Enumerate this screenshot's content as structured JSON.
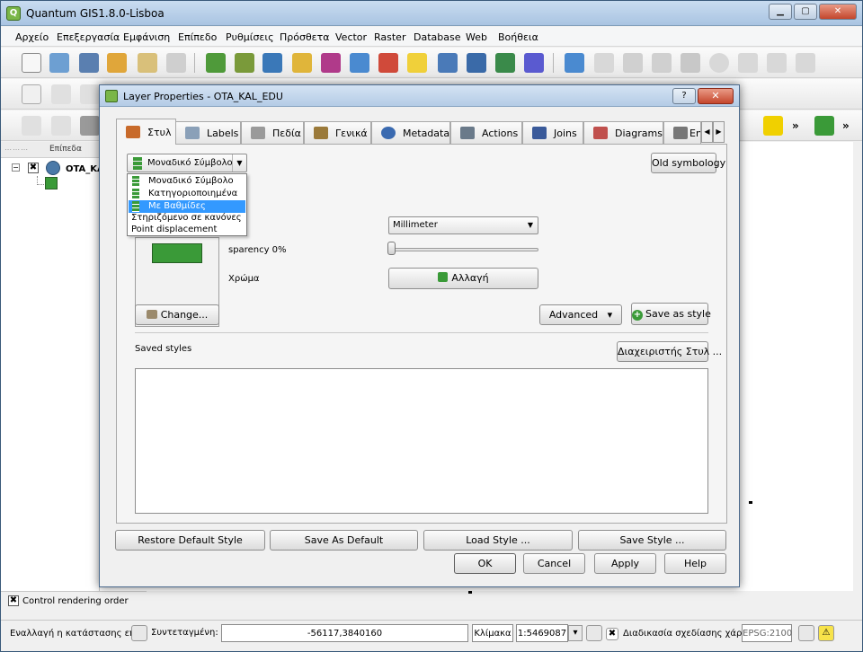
{
  "main_window": {
    "title": "Quantum GIS1.8.0-Lisboa",
    "controls": {
      "minimize": "▁",
      "maximize": "▢",
      "close": "✕"
    }
  },
  "menu": [
    "Αρχείο",
    "Επεξεργασία",
    "Εμφάνιση",
    "Επίπεδο",
    "Ρυθμίσεις",
    "Πρόσθετα",
    "Vector",
    "Raster",
    "Database",
    "Web",
    "Βοήθεια"
  ],
  "toolbar": {
    "more": "»"
  },
  "layers_panel": {
    "header": "Επίπεδα",
    "layer_name": "OTA_KA",
    "expander": "−",
    "check": "✖"
  },
  "control_rendering_order": {
    "label": "Control rendering order",
    "check": "✖"
  },
  "statusbar": {
    "toggle_label": "Εναλλαγή η κατάστασης επεξ",
    "coord_label": "Συντεταγμένη:",
    "coord_value": "-56117,3840160",
    "scale_label": "Κλίμακα",
    "scale_value": "1:5469087",
    "render_label": "Διαδικασία σχεδίασης χάρτη",
    "render_check": "✖",
    "epsg": "EPSG:2100",
    "warn": "⚠"
  },
  "dialog": {
    "title": "Layer Properties - OTA_KAL_EDU",
    "help": "?",
    "close": "✕",
    "tabs": [
      {
        "label": "Στυλ",
        "color": "#c86a2a"
      },
      {
        "label": "Labels",
        "color": "#8aa0b8"
      },
      {
        "label": "Πεδία",
        "color": "#9a9a9a"
      },
      {
        "label": "Γενικά",
        "color": "#9b7a3a"
      },
      {
        "label": "Metadata",
        "color": "#3a6ab0"
      },
      {
        "label": "Actions",
        "color": "#6a7a8a"
      },
      {
        "label": "Joins",
        "color": "#3a5a9a"
      },
      {
        "label": "Diagrams",
        "color": "#c0504d"
      },
      {
        "label": "En",
        "color": "#777777"
      }
    ],
    "tab_scroll": {
      "left": "◀",
      "right": "▶"
    },
    "style": {
      "renderer_selected": "Μοναδικό Σύμβολο",
      "renderer_arrow": "▼",
      "renderer_options": [
        "Μοναδικό Σύμβολο",
        "Κατηγοριοποιημένα",
        "Με Βαθμίδες",
        "Στηριζόμενο σε κανόνες",
        "Point displacement"
      ],
      "highlighted_option_index": 2,
      "old_symbology": "Old symbology",
      "units": "Millimeter",
      "transparency_label": "sparency 0%",
      "transparency_value": 0,
      "color_label": "Χρώμα",
      "color_button": "Αλλαγή",
      "symbol_color": "#3a9a38",
      "change_button": "Change...",
      "advanced_button": "Advanced",
      "advanced_arrow": "▾",
      "save_as_style_button": "Save as style",
      "save_as_style_plus": "+",
      "saved_styles_label": "Saved styles",
      "style_manager_button": "Διαχειριστής Στυλ ..."
    },
    "bottom_buttons": {
      "restore_default": "Restore Default Style",
      "save_as_default": "Save As Default",
      "load_style": "Load Style ...",
      "save_style": "Save Style ..."
    },
    "dialog_buttons": {
      "ok": "OK",
      "cancel": "Cancel",
      "apply": "Apply",
      "help": "Help"
    }
  }
}
